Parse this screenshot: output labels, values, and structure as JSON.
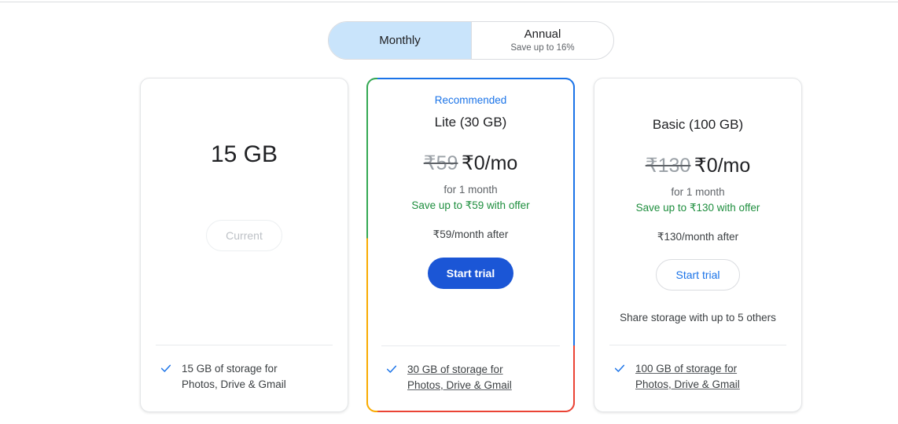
{
  "billing_toggle": {
    "options": [
      {
        "label": "Monthly",
        "sublabel": "",
        "selected": true
      },
      {
        "label": "Annual",
        "sublabel": "Save up to 16%",
        "selected": false
      }
    ],
    "selected_bg": "#c9e4fb"
  },
  "plans": [
    {
      "badge": "",
      "title": "15 GB",
      "price_old": "",
      "price_new": "",
      "price_term": "",
      "price_save": "",
      "price_after": "",
      "cta_label": "Current",
      "cta_style": "disabled",
      "share_note": "",
      "feature_check": "check-icon",
      "feature_line1": "15 GB of storage for",
      "feature_line2": "Photos, Drive & Gmail",
      "feature_underlined": false
    },
    {
      "badge": "Recommended",
      "title": "Lite (30 GB)",
      "price_old": "₹59",
      "price_new": "₹0/mo",
      "price_term": "for 1 month",
      "price_save": "Save up to ₹59 with offer",
      "price_after": "₹59/month after",
      "cta_label": "Start trial",
      "cta_style": "filled",
      "share_note": "",
      "feature_check": "check-icon",
      "feature_line1": "30 GB of storage for",
      "feature_line2": "Photos, Drive & Gmail",
      "feature_underlined": true
    },
    {
      "badge": "",
      "title": "Basic (100 GB)",
      "price_old": "₹130",
      "price_new": "₹0/mo",
      "price_term": "for 1 month",
      "price_save": "Save up to ₹130 with offer",
      "price_after": "₹130/month after",
      "cta_label": "Start trial",
      "cta_style": "outlined",
      "share_note": "Share storage with up to 5 others",
      "feature_check": "check-icon",
      "feature_line1": "100 GB of storage for",
      "feature_line2": "Photos, Drive & Gmail",
      "feature_underlined": true
    }
  ],
  "colors": {
    "accent_blue": "#1a73e8",
    "cta_blue": "#1b56d6",
    "save_green": "#1e8e3e",
    "google_green": "#34a853",
    "google_yellow": "#f9ab00",
    "google_red": "#ea4335"
  }
}
